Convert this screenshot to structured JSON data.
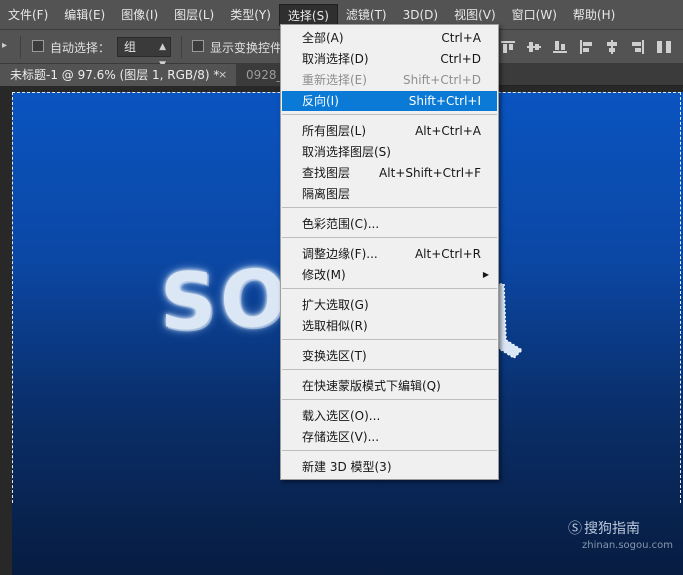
{
  "menubar": {
    "items": [
      {
        "label": "文件(F)"
      },
      {
        "label": "编辑(E)"
      },
      {
        "label": "图像(I)"
      },
      {
        "label": "图层(L)"
      },
      {
        "label": "类型(Y)"
      },
      {
        "label": "选择(S)"
      },
      {
        "label": "滤镜(T)"
      },
      {
        "label": "3D(D)"
      },
      {
        "label": "视图(V)"
      },
      {
        "label": "窗口(W)"
      },
      {
        "label": "帮助(H)"
      }
    ]
  },
  "options_bar": {
    "auto_select_label": "自动选择：",
    "auto_select_value": "组",
    "show_transform_label": "显示变换控件"
  },
  "tabs": {
    "active_label": "未标题-1 @ 97.6% (图层 1, RGB/8) *",
    "close_glyph": "×",
    "inactive_label": "0928_"
  },
  "canvas": {
    "text": "SO",
    "watermark": "搜狗指南",
    "watermark_sub": "zhinan.sogou.com"
  },
  "select_menu": {
    "items": [
      {
        "label": "全部(A)",
        "shortcut": "Ctrl+A"
      },
      {
        "label": "取消选择(D)",
        "shortcut": "Ctrl+D"
      },
      {
        "label": "重新选择(E)",
        "shortcut": "Shift+Ctrl+D",
        "disabled": true
      },
      {
        "label": "反向(I)",
        "shortcut": "Shift+Ctrl+I",
        "highlighted": true
      },
      {
        "label": "所有图层(L)",
        "shortcut": "Alt+Ctrl+A"
      },
      {
        "label": "取消选择图层(S)",
        "shortcut": ""
      },
      {
        "label": "查找图层",
        "shortcut": "Alt+Shift+Ctrl+F"
      },
      {
        "label": "隔离图层",
        "shortcut": ""
      },
      {
        "label": "色彩范围(C)...",
        "shortcut": ""
      },
      {
        "label": "调整边缘(F)...",
        "shortcut": "Alt+Ctrl+R"
      },
      {
        "label": "修改(M)",
        "shortcut": "",
        "submenu": true
      },
      {
        "label": "扩大选取(G)",
        "shortcut": ""
      },
      {
        "label": "选取相似(R)",
        "shortcut": ""
      },
      {
        "label": "变换选区(T)",
        "shortcut": ""
      },
      {
        "label": "在快速蒙版模式下编辑(Q)",
        "shortcut": ""
      },
      {
        "label": "载入选区(O)...",
        "shortcut": ""
      },
      {
        "label": "存储选区(V)...",
        "shortcut": ""
      },
      {
        "label": "新建 3D 模型(3)",
        "shortcut": ""
      }
    ]
  },
  "colors": {
    "menu_highlight": "#0a7ad6",
    "canvas_top": "#0a54c0",
    "canvas_bottom": "#071c40"
  }
}
